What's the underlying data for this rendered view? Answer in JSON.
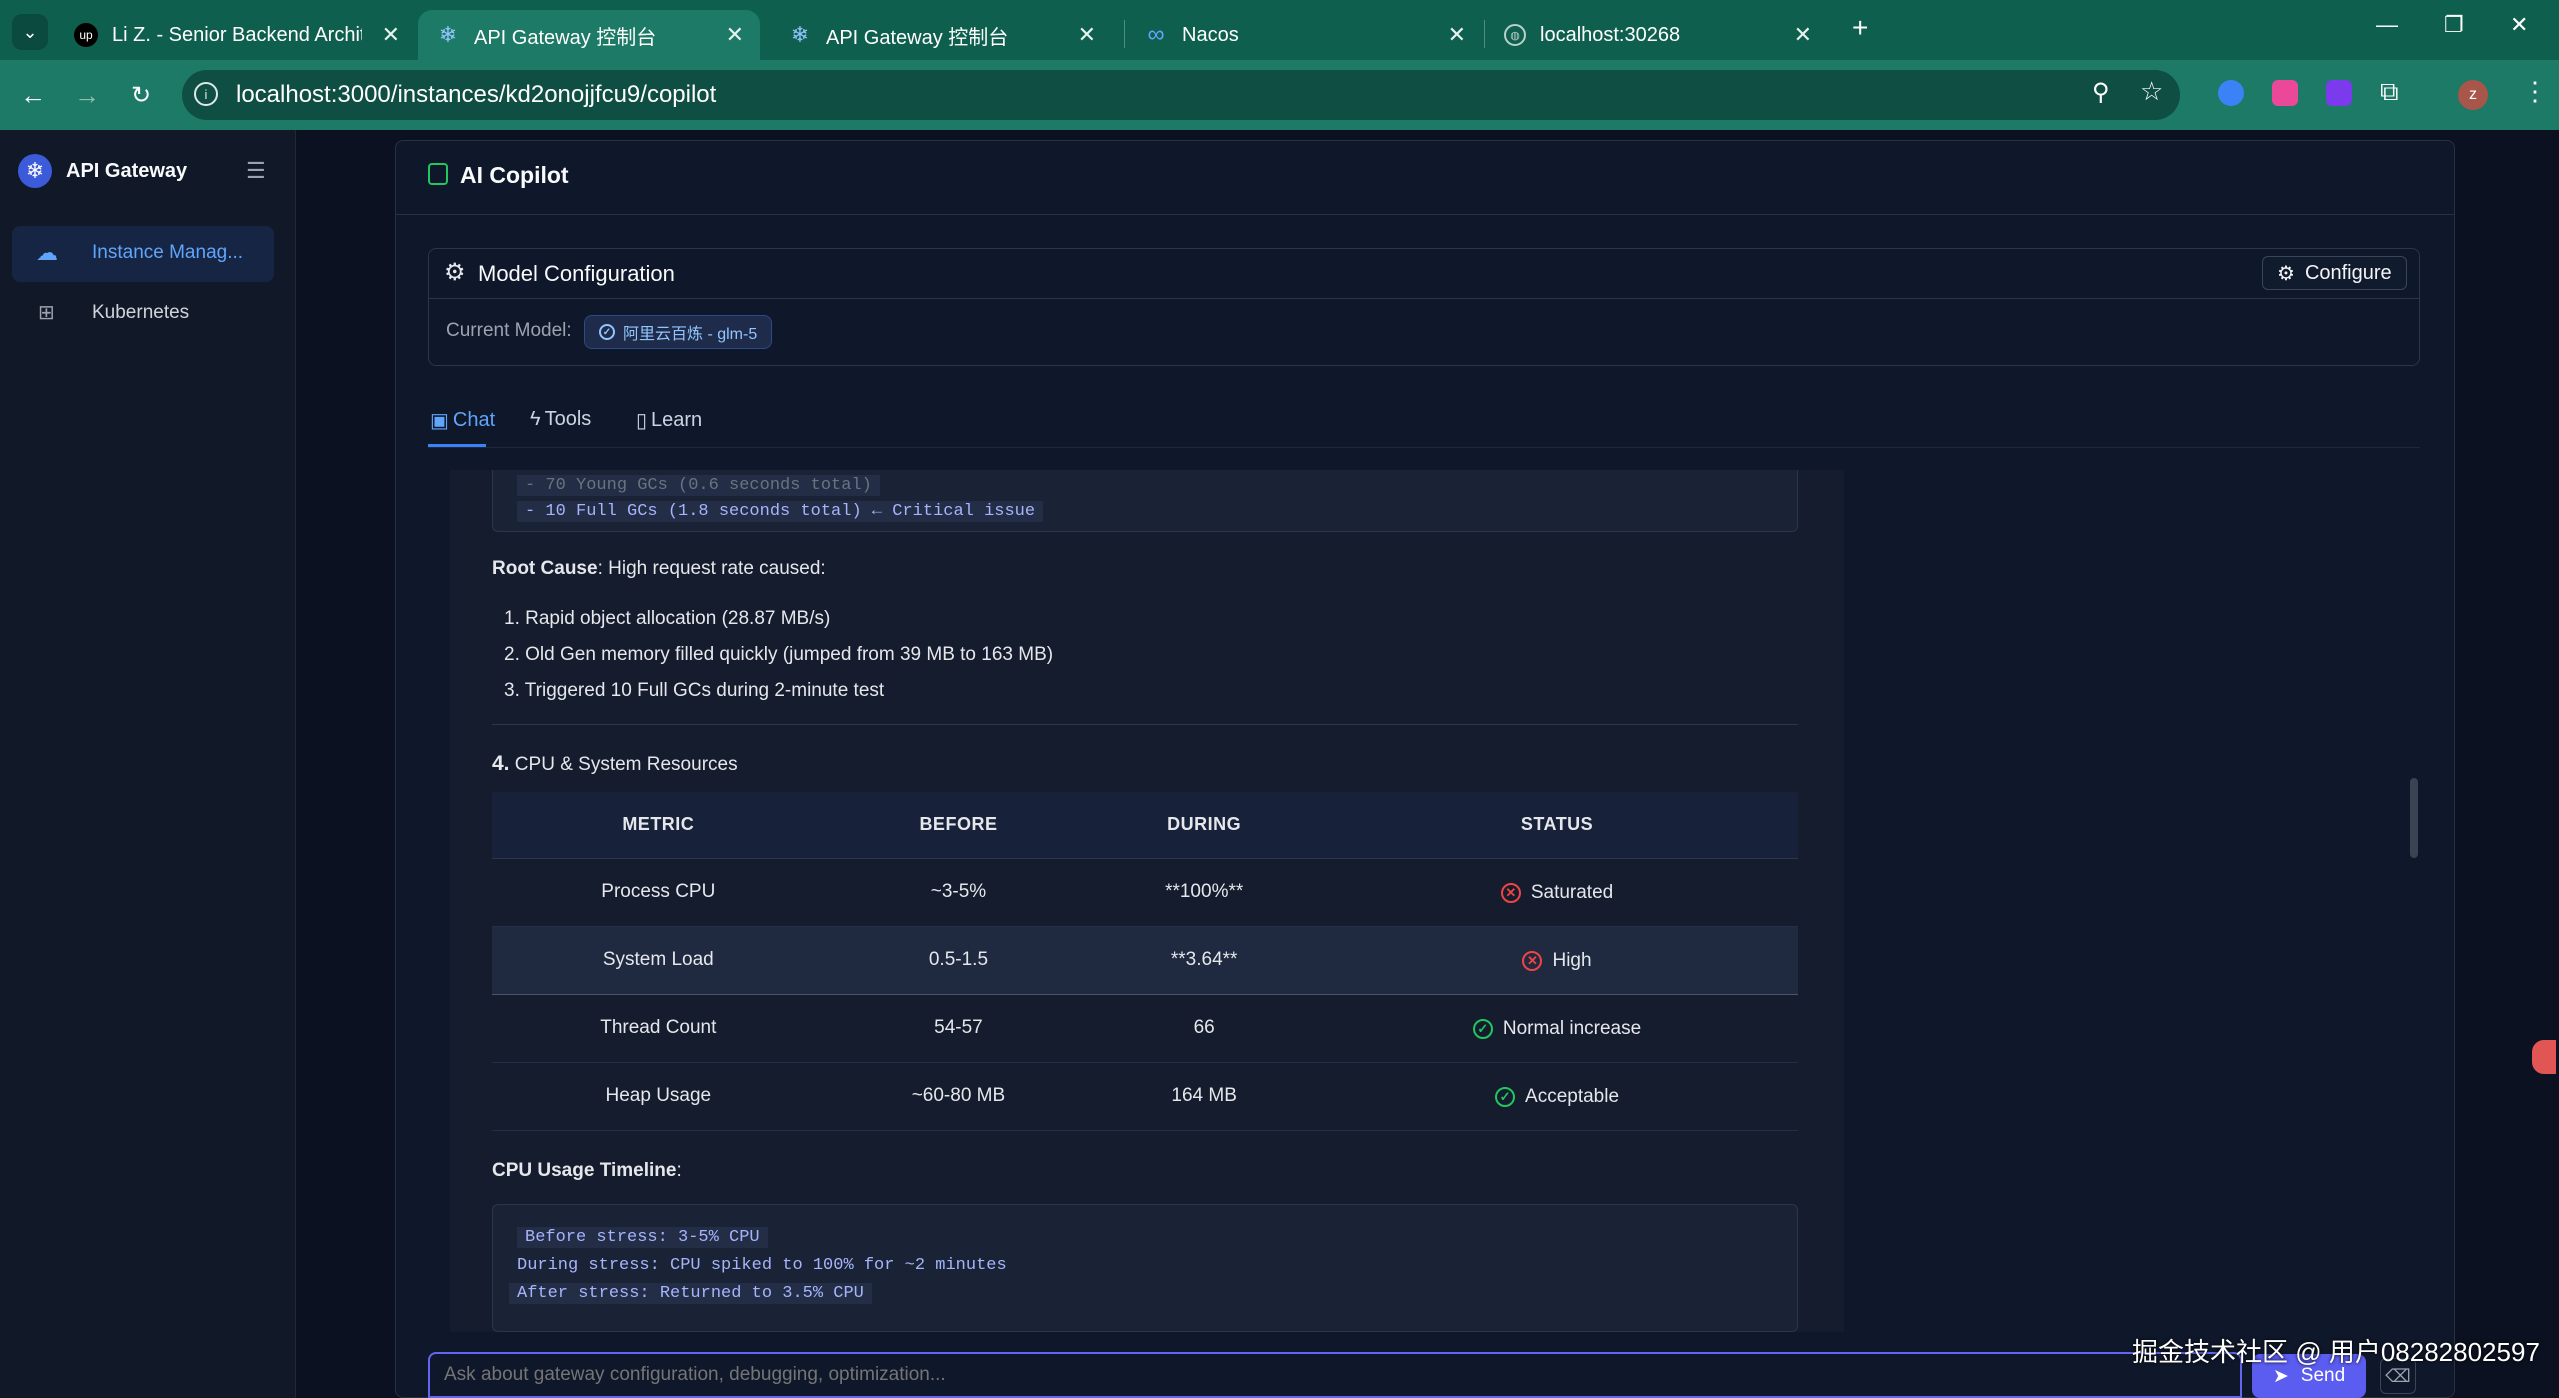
{
  "browser": {
    "tabs": [
      {
        "title": "Li Z. - Senior Backend Archite",
        "favicon": "up"
      },
      {
        "title": "API Gateway 控制台",
        "favicon": "snowflake"
      },
      {
        "title": "API Gateway 控制台",
        "favicon": "snowflake"
      },
      {
        "title": "Nacos",
        "favicon": "infinity"
      },
      {
        "title": "localhost:30268",
        "favicon": "globe"
      }
    ],
    "url": "localhost:3000/instances/kd2onojjfcu9/copilot",
    "avatar_letter": "z"
  },
  "sidebar": {
    "brand": "API Gateway",
    "items": [
      {
        "label": "Instance Manag...",
        "icon": "cloud-icon",
        "active": true
      },
      {
        "label": "Kubernetes",
        "icon": "sitemap-icon",
        "active": false
      }
    ]
  },
  "panel": {
    "title": "AI Copilot"
  },
  "model_config": {
    "title": "Model Configuration",
    "configure_label": "Configure",
    "current_model_label": "Current Model:",
    "current_model_value": "阿里云百炼 - glm-5"
  },
  "tabs": [
    {
      "label": "Chat",
      "active": true
    },
    {
      "label": "Tools",
      "active": false
    },
    {
      "label": "Learn",
      "active": false
    }
  ],
  "message": {
    "code_top": {
      "line_partial": "- 70 Young GCs (0.6 seconds total)",
      "line": "- 10 Full GCs (1.8 seconds total) ← Critical issue"
    },
    "root_cause_label": "Root Cause",
    "root_cause_text": ": High request rate caused:",
    "causes": [
      "1. Rapid object allocation (28.87 MB/s)",
      "2. Old Gen memory filled quickly (jumped from 39 MB to 163 MB)",
      "3. Triggered 10 Full GCs during 2-minute test"
    ],
    "section_number": "4.",
    "section_title": "CPU & System Resources",
    "table": {
      "headers": [
        "METRIC",
        "BEFORE",
        "DURING",
        "STATUS"
      ],
      "rows": [
        {
          "metric": "Process CPU",
          "before": "~3-5%",
          "during": "**100%**",
          "status": "Saturated",
          "ok": false
        },
        {
          "metric": "System Load",
          "before": "0.5-1.5",
          "during": "**3.64**",
          "status": "High",
          "ok": false
        },
        {
          "metric": "Thread Count",
          "before": "54-57",
          "during": "66",
          "status": "Normal increase",
          "ok": true
        },
        {
          "metric": "Heap Usage",
          "before": "~60-80 MB",
          "during": "164 MB",
          "status": "Acceptable",
          "ok": true
        }
      ]
    },
    "timeline_label": "CPU Usage Timeline",
    "timeline_colon": ":",
    "timeline_lines": [
      "Before stress: 3-5% CPU",
      "During stress: CPU spiked to 100% for ~2 minutes",
      "After stress:  Returned to 3.5% CPU"
    ]
  },
  "input": {
    "placeholder": "Ask about gateway configuration, debugging, optimization...",
    "send_label": "Send"
  },
  "watermark": "掘金技术社区 @ 用户08282802597",
  "colors": {
    "accent": "#5b5cf0",
    "danger": "#ef4444",
    "success": "#22c55e",
    "chrome": "#1c7a66"
  }
}
